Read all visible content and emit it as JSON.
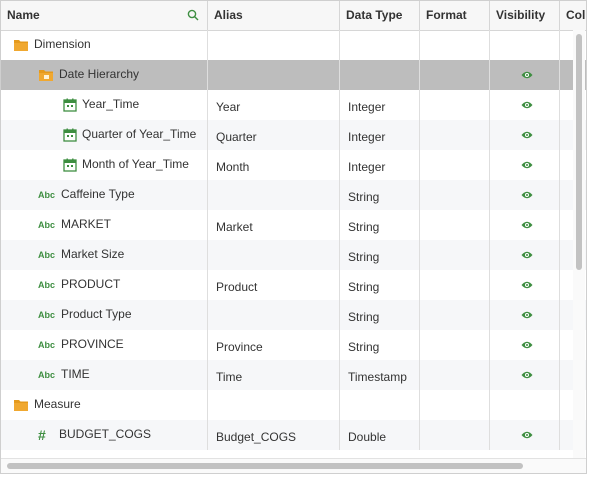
{
  "columns": {
    "name": "Name",
    "alias": "Alias",
    "data_type": "Data Type",
    "format": "Format",
    "visibility": "Visibility",
    "col": "Col"
  },
  "rows": [
    {
      "name": "Dimension",
      "alias": "",
      "data_type": "",
      "icon": "folder-icon",
      "level": 0,
      "visible": false,
      "selected": false,
      "alt": false
    },
    {
      "name": "Date Hierarchy",
      "alias": "",
      "data_type": "",
      "icon": "date-folder-icon",
      "level": 1,
      "visible": true,
      "selected": true,
      "alt": false
    },
    {
      "name": "Year_Time",
      "alias": "Year",
      "data_type": "Integer",
      "icon": "calendar-icon",
      "level": 2,
      "visible": true,
      "selected": false,
      "alt": false
    },
    {
      "name": "Quarter of Year_Time",
      "alias": "Quarter",
      "data_type": "Integer",
      "icon": "calendar-icon",
      "level": 2,
      "visible": true,
      "selected": false,
      "alt": true
    },
    {
      "name": "Month of Year_Time",
      "alias": "Month",
      "data_type": "Integer",
      "icon": "calendar-icon",
      "level": 2,
      "visible": true,
      "selected": false,
      "alt": false
    },
    {
      "name": "Caffeine Type",
      "alias": "",
      "data_type": "String",
      "icon": "string-type-icon",
      "level": 1,
      "visible": true,
      "selected": false,
      "alt": true
    },
    {
      "name": "MARKET",
      "alias": "Market",
      "data_type": "String",
      "icon": "string-type-icon",
      "level": 1,
      "visible": true,
      "selected": false,
      "alt": false
    },
    {
      "name": "Market Size",
      "alias": "",
      "data_type": "String",
      "icon": "string-type-icon",
      "level": 1,
      "visible": true,
      "selected": false,
      "alt": true
    },
    {
      "name": "PRODUCT",
      "alias": "Product",
      "data_type": "String",
      "icon": "string-type-icon",
      "level": 1,
      "visible": true,
      "selected": false,
      "alt": false
    },
    {
      "name": "Product Type",
      "alias": "",
      "data_type": "String",
      "icon": "string-type-icon",
      "level": 1,
      "visible": true,
      "selected": false,
      "alt": true
    },
    {
      "name": "PROVINCE",
      "alias": "Province",
      "data_type": "String",
      "icon": "string-type-icon",
      "level": 1,
      "visible": true,
      "selected": false,
      "alt": false
    },
    {
      "name": "TIME",
      "alias": "Time",
      "data_type": "Timestamp",
      "icon": "string-type-icon",
      "level": 1,
      "visible": true,
      "selected": false,
      "alt": true
    },
    {
      "name": "Measure",
      "alias": "",
      "data_type": "",
      "icon": "folder-icon",
      "level": 0,
      "visible": false,
      "selected": false,
      "alt": false
    },
    {
      "name": "BUDGET_COGS",
      "alias": "Budget_COGS",
      "data_type": "Double",
      "icon": "number-type-icon",
      "level": 1,
      "visible": true,
      "selected": false,
      "alt": true
    }
  ],
  "icon_text": {
    "string_type": "Abc",
    "number_type": "#"
  },
  "colors": {
    "accent_green": "#3e8e41",
    "folder_orange": "#f0a830",
    "selected_row": "#bdbdbd"
  }
}
